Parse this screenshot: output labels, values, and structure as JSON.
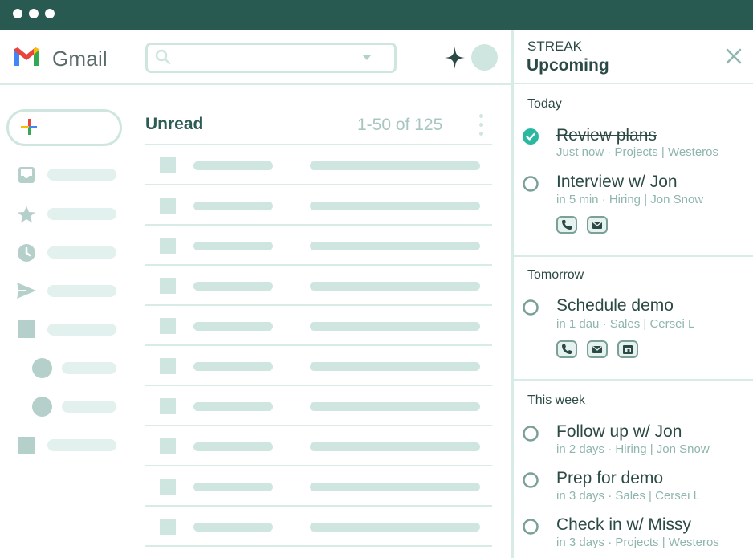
{
  "app": {
    "name": "Gmail"
  },
  "mail": {
    "folder_title": "Unread",
    "count_label": "1-50 of 125"
  },
  "streak": {
    "brand": "STREAK",
    "panel_title": "Upcoming",
    "sections": [
      {
        "heading": "Today",
        "tasks": [
          {
            "title": "Review plans",
            "subtitle": "Just now · Projects | Westeros",
            "completed": true
          },
          {
            "title": "Interview w/ Jon",
            "subtitle": "in 5 min · Hiring | Jon Snow",
            "completed": false
          }
        ]
      },
      {
        "heading": "Tomorrow",
        "tasks": [
          {
            "title": "Schedule demo",
            "subtitle": "in 1 dau · Sales | Cersei L",
            "completed": false
          }
        ]
      },
      {
        "heading": "This week",
        "tasks": [
          {
            "title": "Follow up w/ Jon",
            "subtitle": "in 2 days · Hiring | Jon Snow",
            "completed": false
          },
          {
            "title": "Prep for demo",
            "subtitle": "in 3 days · Sales | Cersei L",
            "completed": false
          },
          {
            "title": "Check in w/ Missy",
            "subtitle": "in 3 days · Projects | Westeros",
            "completed": false
          }
        ]
      }
    ]
  },
  "colors": {
    "titlebar": "#285a52",
    "accent": "#2bb8a0",
    "placeholder": "#cfe5e0",
    "text": "#2c4a45",
    "muted": "#8eb5ae"
  },
  "icons": {
    "window_controls": [
      "window-dot",
      "window-dot",
      "window-dot"
    ],
    "header": [
      "gmail-logo",
      "search-icon",
      "dropdown-caret-icon",
      "sparkle-icon",
      "avatar"
    ],
    "nav": [
      "inbox-icon",
      "star-icon",
      "clock-icon",
      "send-icon",
      "square-icon",
      "circle-icon",
      "circle-icon",
      "square-icon"
    ],
    "task_actions": [
      "phone-icon",
      "mail-icon",
      "calendar-icon"
    ]
  }
}
